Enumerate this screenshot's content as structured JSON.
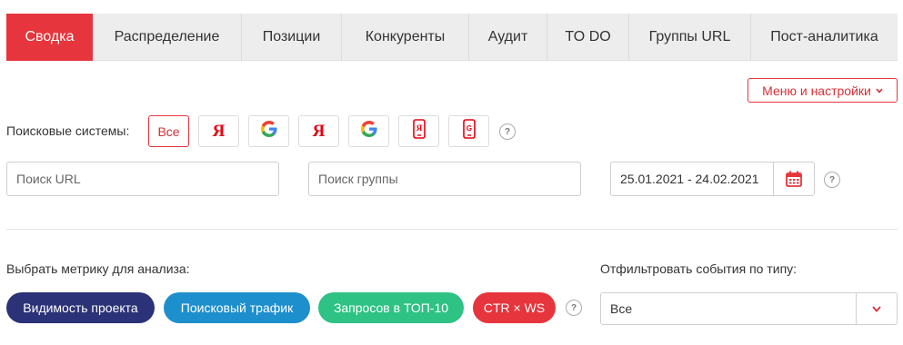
{
  "tabs": [
    {
      "label": "Сводка",
      "active": true
    },
    {
      "label": "Распределение"
    },
    {
      "label": "Позиции"
    },
    {
      "label": "Конкуренты"
    },
    {
      "label": "Аудит"
    },
    {
      "label": "TO DO"
    },
    {
      "label": "Группы URL"
    },
    {
      "label": "Пост-аналитика"
    }
  ],
  "menu_button": "Меню и настройки",
  "search_engines": {
    "label": "Поисковые системы:",
    "all_label": "Все",
    "yandex_letter": "Я",
    "buttons": [
      "yandex-icon",
      "google-icon",
      "yandex-icon",
      "google-icon",
      "yandex-mobile-icon",
      "google-mobile-icon"
    ],
    "help": "?"
  },
  "filters": {
    "url_placeholder": "Поиск URL",
    "group_placeholder": "Поиск группы",
    "date_range": "25.01.2021 - 24.02.2021",
    "help": "?"
  },
  "metrics": {
    "label": "Выбрать метрику для анализа:",
    "items": [
      {
        "label": "Видимость проекта",
        "color": "#2b3277"
      },
      {
        "label": "Поисковый трафик",
        "color": "#1e8fcd"
      },
      {
        "label": "Запросов в ТОП-10",
        "color": "#2ec285"
      },
      {
        "label": "CTR × WS",
        "color": "#e6353c"
      }
    ],
    "help": "?"
  },
  "event_filter": {
    "label": "Отфильтровать события по типу:",
    "value": "Все"
  },
  "colors": {
    "accent": "#e6353c",
    "tab_bg": "#ededed"
  }
}
